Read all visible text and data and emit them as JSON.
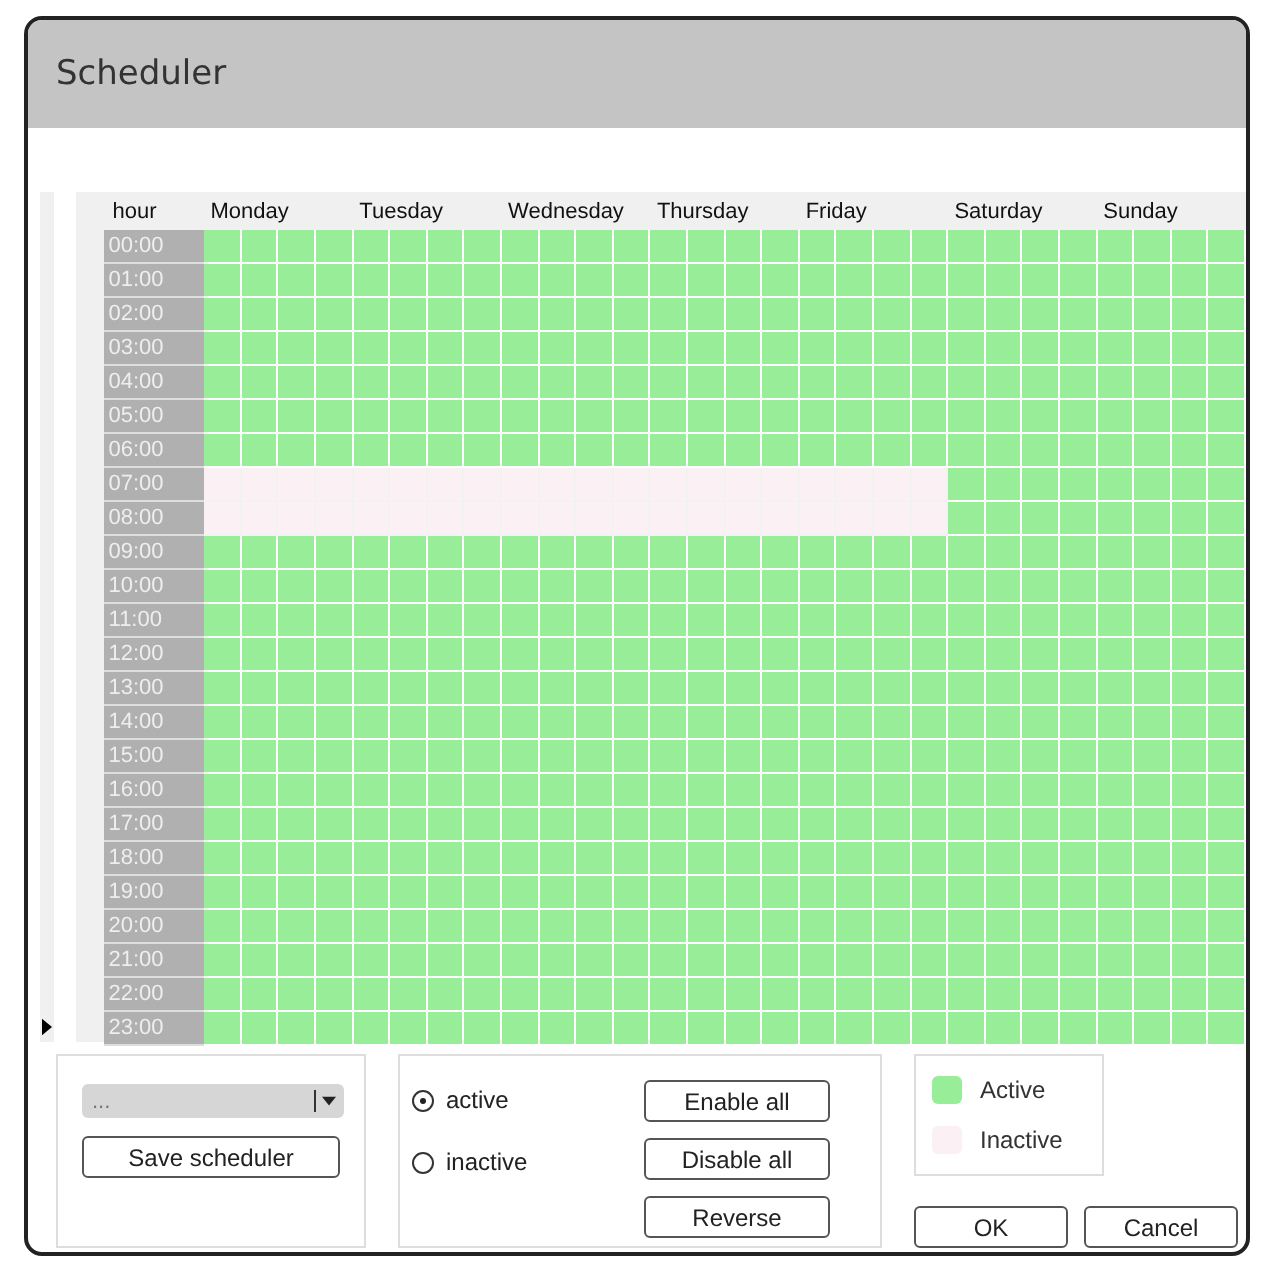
{
  "window": {
    "title": "Scheduler"
  },
  "grid": {
    "hour_header": "hour",
    "days": [
      "Monday",
      "Tuesday",
      "Wednesday",
      "Thursday",
      "Friday",
      "Saturday",
      "Sunday"
    ],
    "rows": [
      {
        "hour": "00:00",
        "slots": [
          true,
          true,
          true,
          true,
          true,
          true,
          true,
          true,
          true,
          true,
          true,
          true,
          true,
          true,
          true,
          true,
          true,
          true,
          true,
          true,
          true,
          true,
          true,
          true,
          true,
          true,
          true,
          true
        ]
      },
      {
        "hour": "01:00",
        "slots": [
          true,
          true,
          true,
          true,
          true,
          true,
          true,
          true,
          true,
          true,
          true,
          true,
          true,
          true,
          true,
          true,
          true,
          true,
          true,
          true,
          true,
          true,
          true,
          true,
          true,
          true,
          true,
          true
        ]
      },
      {
        "hour": "02:00",
        "slots": [
          true,
          true,
          true,
          true,
          true,
          true,
          true,
          true,
          true,
          true,
          true,
          true,
          true,
          true,
          true,
          true,
          true,
          true,
          true,
          true,
          true,
          true,
          true,
          true,
          true,
          true,
          true,
          true
        ]
      },
      {
        "hour": "03:00",
        "slots": [
          true,
          true,
          true,
          true,
          true,
          true,
          true,
          true,
          true,
          true,
          true,
          true,
          true,
          true,
          true,
          true,
          true,
          true,
          true,
          true,
          true,
          true,
          true,
          true,
          true,
          true,
          true,
          true
        ]
      },
      {
        "hour": "04:00",
        "slots": [
          true,
          true,
          true,
          true,
          true,
          true,
          true,
          true,
          true,
          true,
          true,
          true,
          true,
          true,
          true,
          true,
          true,
          true,
          true,
          true,
          true,
          true,
          true,
          true,
          true,
          true,
          true,
          true
        ]
      },
      {
        "hour": "05:00",
        "slots": [
          true,
          true,
          true,
          true,
          true,
          true,
          true,
          true,
          true,
          true,
          true,
          true,
          true,
          true,
          true,
          true,
          true,
          true,
          true,
          true,
          true,
          true,
          true,
          true,
          true,
          true,
          true,
          true
        ]
      },
      {
        "hour": "06:00",
        "slots": [
          true,
          true,
          true,
          true,
          true,
          true,
          true,
          true,
          true,
          true,
          true,
          true,
          true,
          true,
          true,
          true,
          true,
          true,
          true,
          true,
          true,
          true,
          true,
          true,
          true,
          true,
          true,
          true
        ]
      },
      {
        "hour": "07:00",
        "slots": [
          false,
          false,
          false,
          false,
          false,
          false,
          false,
          false,
          false,
          false,
          false,
          false,
          false,
          false,
          false,
          false,
          false,
          false,
          false,
          false,
          true,
          true,
          true,
          true,
          true,
          true,
          true,
          true
        ]
      },
      {
        "hour": "08:00",
        "slots": [
          false,
          false,
          false,
          false,
          false,
          false,
          false,
          false,
          false,
          false,
          false,
          false,
          false,
          false,
          false,
          false,
          false,
          false,
          false,
          false,
          true,
          true,
          true,
          true,
          true,
          true,
          true,
          true
        ]
      },
      {
        "hour": "09:00",
        "slots": [
          true,
          true,
          true,
          true,
          true,
          true,
          true,
          true,
          true,
          true,
          true,
          true,
          true,
          true,
          true,
          true,
          true,
          true,
          true,
          true,
          true,
          true,
          true,
          true,
          true,
          true,
          true,
          true
        ]
      },
      {
        "hour": "10:00",
        "slots": [
          true,
          true,
          true,
          true,
          true,
          true,
          true,
          true,
          true,
          true,
          true,
          true,
          true,
          true,
          true,
          true,
          true,
          true,
          true,
          true,
          true,
          true,
          true,
          true,
          true,
          true,
          true,
          true
        ]
      },
      {
        "hour": "11:00",
        "slots": [
          true,
          true,
          true,
          true,
          true,
          true,
          true,
          true,
          true,
          true,
          true,
          true,
          true,
          true,
          true,
          true,
          true,
          true,
          true,
          true,
          true,
          true,
          true,
          true,
          true,
          true,
          true,
          true
        ]
      },
      {
        "hour": "12:00",
        "slots": [
          true,
          true,
          true,
          true,
          true,
          true,
          true,
          true,
          true,
          true,
          true,
          true,
          true,
          true,
          true,
          true,
          true,
          true,
          true,
          true,
          true,
          true,
          true,
          true,
          true,
          true,
          true,
          true
        ]
      },
      {
        "hour": "13:00",
        "slots": [
          true,
          true,
          true,
          true,
          true,
          true,
          true,
          true,
          true,
          true,
          true,
          true,
          true,
          true,
          true,
          true,
          true,
          true,
          true,
          true,
          true,
          true,
          true,
          true,
          true,
          true,
          true,
          true
        ]
      },
      {
        "hour": "14:00",
        "slots": [
          true,
          true,
          true,
          true,
          true,
          true,
          true,
          true,
          true,
          true,
          true,
          true,
          true,
          true,
          true,
          true,
          true,
          true,
          true,
          true,
          true,
          true,
          true,
          true,
          true,
          true,
          true,
          true
        ]
      },
      {
        "hour": "15:00",
        "slots": [
          true,
          true,
          true,
          true,
          true,
          true,
          true,
          true,
          true,
          true,
          true,
          true,
          true,
          true,
          true,
          true,
          true,
          true,
          true,
          true,
          true,
          true,
          true,
          true,
          true,
          true,
          true,
          true
        ]
      },
      {
        "hour": "16:00",
        "slots": [
          true,
          true,
          true,
          true,
          true,
          true,
          true,
          true,
          true,
          true,
          true,
          true,
          true,
          true,
          true,
          true,
          true,
          true,
          true,
          true,
          true,
          true,
          true,
          true,
          true,
          true,
          true,
          true
        ]
      },
      {
        "hour": "17:00",
        "slots": [
          true,
          true,
          true,
          true,
          true,
          true,
          true,
          true,
          true,
          true,
          true,
          true,
          true,
          true,
          true,
          true,
          true,
          true,
          true,
          true,
          true,
          true,
          true,
          true,
          true,
          true,
          true,
          true
        ]
      },
      {
        "hour": "18:00",
        "slots": [
          true,
          true,
          true,
          true,
          true,
          true,
          true,
          true,
          true,
          true,
          true,
          true,
          true,
          true,
          true,
          true,
          true,
          true,
          true,
          true,
          true,
          true,
          true,
          true,
          true,
          true,
          true,
          true
        ]
      },
      {
        "hour": "19:00",
        "slots": [
          true,
          true,
          true,
          true,
          true,
          true,
          true,
          true,
          true,
          true,
          true,
          true,
          true,
          true,
          true,
          true,
          true,
          true,
          true,
          true,
          true,
          true,
          true,
          true,
          true,
          true,
          true,
          true
        ]
      },
      {
        "hour": "20:00",
        "slots": [
          true,
          true,
          true,
          true,
          true,
          true,
          true,
          true,
          true,
          true,
          true,
          true,
          true,
          true,
          true,
          true,
          true,
          true,
          true,
          true,
          true,
          true,
          true,
          true,
          true,
          true,
          true,
          true
        ]
      },
      {
        "hour": "21:00",
        "slots": [
          true,
          true,
          true,
          true,
          true,
          true,
          true,
          true,
          true,
          true,
          true,
          true,
          true,
          true,
          true,
          true,
          true,
          true,
          true,
          true,
          true,
          true,
          true,
          true,
          true,
          true,
          true,
          true
        ]
      },
      {
        "hour": "22:00",
        "slots": [
          true,
          true,
          true,
          true,
          true,
          true,
          true,
          true,
          true,
          true,
          true,
          true,
          true,
          true,
          true,
          true,
          true,
          true,
          true,
          true,
          true,
          true,
          true,
          true,
          true,
          true,
          true,
          true
        ]
      },
      {
        "hour": "23:00",
        "slots": [
          true,
          true,
          true,
          true,
          true,
          true,
          true,
          true,
          true,
          true,
          true,
          true,
          true,
          true,
          true,
          true,
          true,
          true,
          true,
          true,
          true,
          true,
          true,
          true,
          true,
          true,
          true,
          true
        ]
      }
    ]
  },
  "scheduler_select": {
    "value": "..."
  },
  "save_button": "Save scheduler",
  "mode_options": [
    {
      "label": "active",
      "selected": true
    },
    {
      "label": "inactive",
      "selected": false
    }
  ],
  "action_buttons": [
    "Enable all",
    "Disable all",
    "Reverse"
  ],
  "legend": [
    {
      "label": "Active",
      "color": "#98ee98"
    },
    {
      "label": "Inactive",
      "color": "#fbf0f4"
    }
  ],
  "dialog_buttons": [
    "OK",
    "Cancel"
  ]
}
